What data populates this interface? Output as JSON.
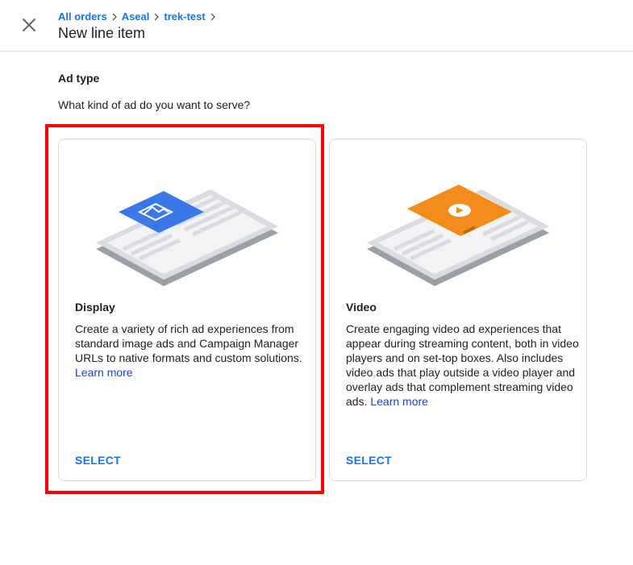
{
  "header": {
    "breadcrumbs": [
      "All orders",
      "Aseal",
      "trek-test"
    ],
    "title": "New line item"
  },
  "section": {
    "title": "Ad type",
    "question": "What kind of ad do you want to serve?"
  },
  "cards": [
    {
      "name": "Display",
      "description": "Create a variety of rich ad experiences from standard image ads and Campaign Manager URLs to native formats and custom solutions.",
      "learn_more": "Learn more",
      "select": "SELECT",
      "accent": "#3b78e7",
      "highlighted": true
    },
    {
      "name": "Video",
      "description": "Create engaging video ad experiences that appear during streaming content, both in video players and on set-top boxes. Also includes video ads that play outside a video player and overlay ads that complement streaming video ads.",
      "learn_more": "Learn more",
      "select": "SELECT",
      "accent": "#f28c1a",
      "highlighted": false
    }
  ],
  "icons": {
    "close": "close-icon",
    "breadcrumb_separator": "chevron-right-icon",
    "display_illustration": "display-ad-illustration",
    "video_illustration": "video-ad-illustration"
  },
  "colors": {
    "link": "#1a73e8",
    "highlight_border": "#ff0000"
  }
}
